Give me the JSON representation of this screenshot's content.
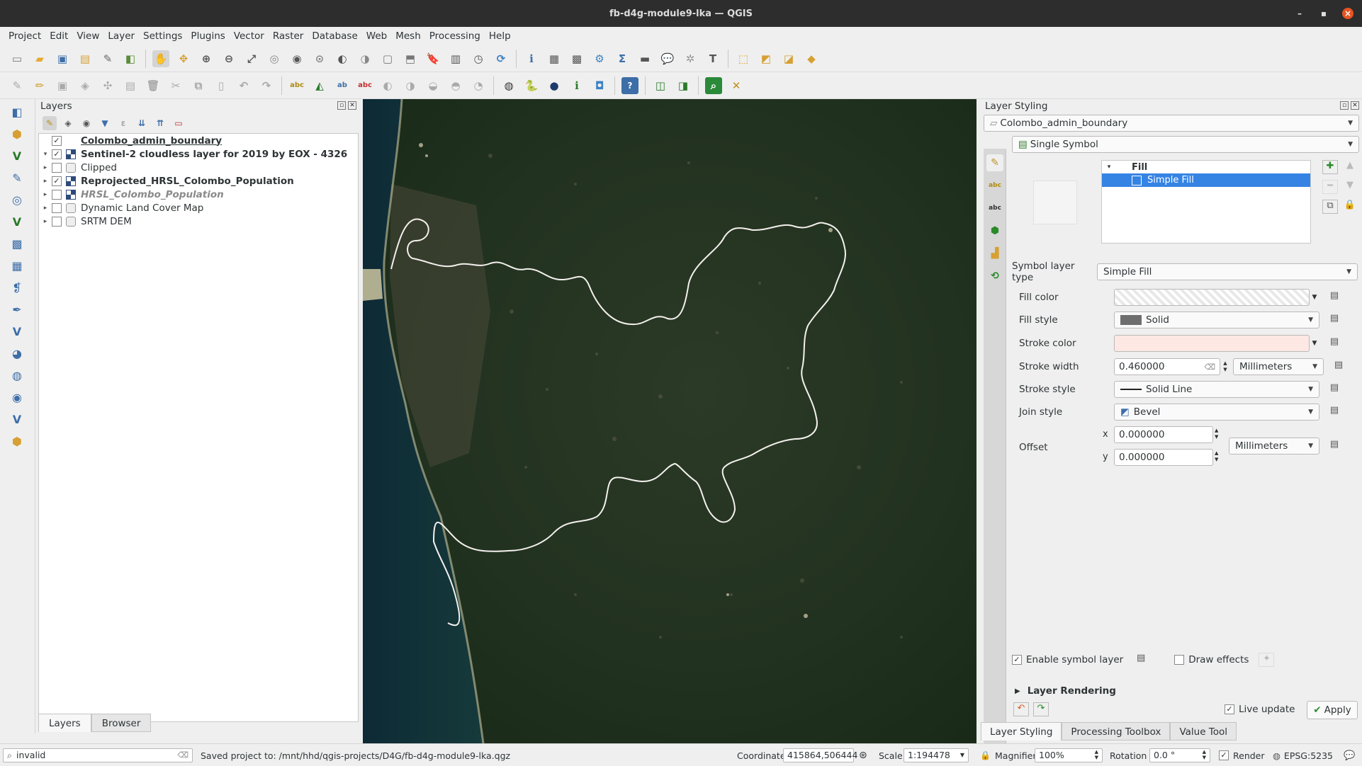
{
  "window": {
    "title": "fb-d4g-module9-lka — QGIS",
    "minimize": "–",
    "maximize": "▪",
    "close": "×"
  },
  "menu": [
    "Project",
    "Edit",
    "View",
    "Layer",
    "Settings",
    "Plugins",
    "Vector",
    "Raster",
    "Database",
    "Web",
    "Mesh",
    "Processing",
    "Help"
  ],
  "layers_panel": {
    "title": "Layers",
    "items": [
      {
        "label": "Colombo_admin_boundary",
        "checked": "✓",
        "expand": "",
        "style": "bold ul"
      },
      {
        "label": "Sentinel-2 cloudless layer for 2019 by EOX - 4326",
        "checked": "✓",
        "expand": "▾",
        "style": "bold"
      },
      {
        "label": "Clipped",
        "checked": "",
        "expand": "▸",
        "style": ""
      },
      {
        "label": "Reprojected_HRSL_Colombo_Population",
        "checked": "✓",
        "expand": "▸",
        "style": "bold"
      },
      {
        "label": "HRSL_Colombo_Population",
        "checked": "",
        "expand": "▸",
        "style": "bold ital"
      },
      {
        "label": "Dynamic Land Cover Map",
        "checked": "",
        "expand": "▸",
        "style": ""
      },
      {
        "label": "SRTM DEM",
        "checked": "",
        "expand": "▸",
        "style": ""
      }
    ],
    "tabs": [
      "Layers",
      "Browser"
    ]
  },
  "styling": {
    "title": "Layer Styling",
    "layer": "Colombo_admin_boundary",
    "renderer": "Single Symbol",
    "tree_root": "Fill",
    "tree_child": "Simple Fill",
    "symbol_layer_type_label": "Symbol layer type",
    "symbol_layer_type": "Simple Fill",
    "fill_color_label": "Fill color",
    "fill_style_label": "Fill style",
    "fill_style": "Solid",
    "stroke_color_label": "Stroke color",
    "stroke_width_label": "Stroke width",
    "stroke_width": "0.460000",
    "stroke_width_unit": "Millimeters",
    "stroke_style_label": "Stroke style",
    "stroke_style": "Solid Line",
    "join_style_label": "Join style",
    "join_style": "Bevel",
    "offset_label": "Offset",
    "offset_x_label": "x",
    "offset_x": "0.000000",
    "offset_y_label": "y",
    "offset_y": "0.000000",
    "offset_unit": "Millimeters",
    "enable_symbol_layer": "Enable symbol layer",
    "draw_effects": "Draw effects",
    "layer_rendering": "Layer Rendering",
    "live_update": "Live update",
    "apply": "Apply",
    "stroke_color": "#fde8e4"
  },
  "bottom_tabs": [
    "Layer Styling",
    "Processing Toolbox",
    "Value Tool"
  ],
  "status": {
    "search": "invalid",
    "message": "Saved project to: /mnt/hhd/qgis-projects/D4G/fb-d4g-module9-lka.qgz",
    "coordinate_label": "Coordinate",
    "coordinate": "415864,506444",
    "scale_label": "Scale",
    "scale": "1:194478",
    "magnifier_label": "Magnifier",
    "magnifier": "100%",
    "rotation_label": "Rotation",
    "rotation": "0.0 °",
    "render": "Render",
    "crs": "EPSG:5235"
  }
}
